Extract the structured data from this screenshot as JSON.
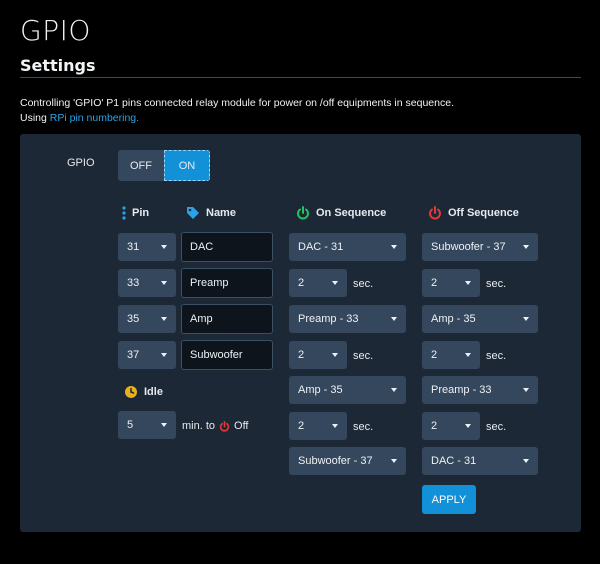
{
  "page": {
    "title": "GPIO",
    "section": "Settings",
    "desc_line1": "Controlling 'GPIO' P1 pins connected relay module for power on /off equipments in sequence.",
    "desc_line2_prefix": "Using ",
    "desc_link": "RPi pin numbering."
  },
  "gpio": {
    "label": "GPIO",
    "off_label": "OFF",
    "on_label": "ON",
    "state": "ON"
  },
  "headers": {
    "pin": "Pin",
    "name": "Name",
    "on_sequence": "On Sequence",
    "off_sequence": "Off Sequence"
  },
  "pins": [
    {
      "pin": "31",
      "name": "DAC"
    },
    {
      "pin": "33",
      "name": "Preamp"
    },
    {
      "pin": "35",
      "name": "Amp"
    },
    {
      "pin": "37",
      "name": "Subwoofer"
    }
  ],
  "idle": {
    "label": "Idle",
    "value": "5",
    "suffix_prefix": "min. to",
    "suffix_off": "Off"
  },
  "on_sequence": [
    {
      "device": "DAC - 31",
      "delay": "2",
      "unit": "sec."
    },
    {
      "device": "Preamp - 33",
      "delay": "2",
      "unit": "sec."
    },
    {
      "device": "Amp - 35",
      "delay": "2",
      "unit": "sec."
    },
    {
      "device": "Subwoofer - 37"
    }
  ],
  "off_sequence": [
    {
      "device": "Subwoofer - 37",
      "delay": "2",
      "unit": "sec."
    },
    {
      "device": "Amp - 35",
      "delay": "2",
      "unit": "sec."
    },
    {
      "device": "Preamp - 33",
      "delay": "2",
      "unit": "sec."
    },
    {
      "device": "DAC - 31"
    }
  ],
  "apply_label": "APPLY",
  "colors": {
    "accent": "#1290d8",
    "on_icon": "#22c55e",
    "off_icon": "#e53935",
    "idle_icon": "#e8b020",
    "pin_icon": "#2aa3e6"
  },
  "icons": {
    "pin": "ellipsis-vertical-icon",
    "name": "tag-icon",
    "on": "power-icon",
    "off": "power-icon",
    "idle": "clock-icon"
  }
}
